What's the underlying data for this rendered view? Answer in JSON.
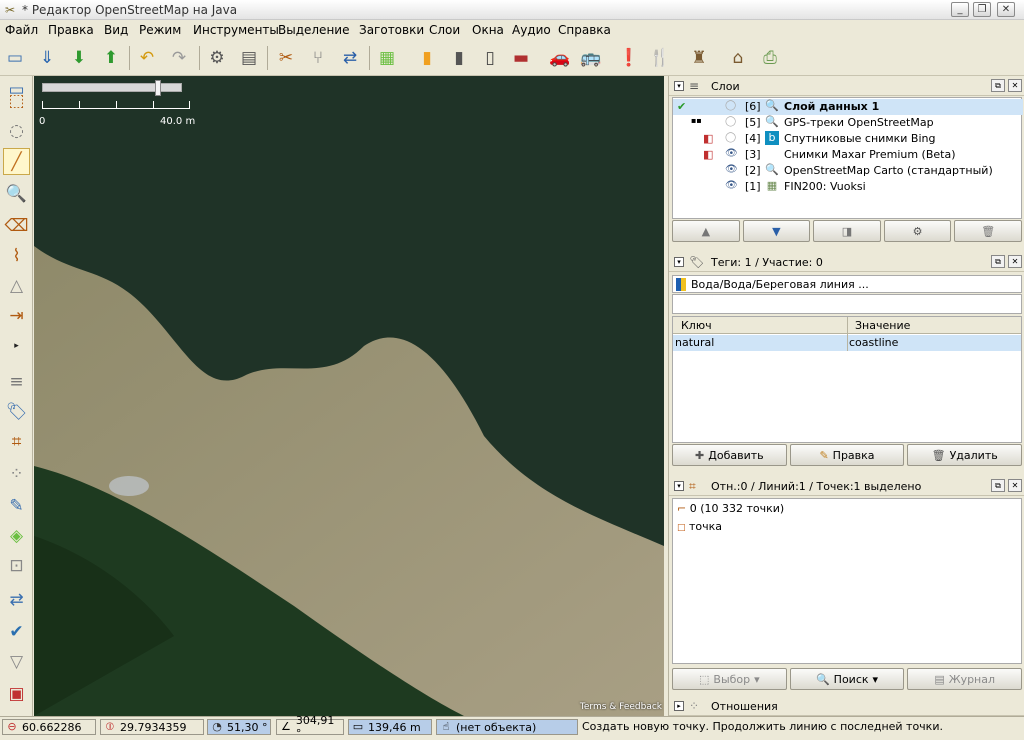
{
  "window": {
    "title": "* Редактор OpenStreetMap на Java",
    "app_icon": "josm-icon",
    "controls": [
      "minimize-icon",
      "restore-icon",
      "close-icon"
    ]
  },
  "menubar": {
    "items": [
      "Файл",
      "Правка",
      "Вид",
      "Режим",
      "Инструменты",
      "Выделение",
      "Заготовки",
      "Слои",
      "Окна",
      "Аудио",
      "Справка"
    ]
  },
  "toolbar": {
    "buttons": [
      "open-file-icon",
      "save-icon",
      "download-icon",
      "upload-icon",
      "undo-icon",
      "redo-icon",
      "preferences-icon",
      "layer-properties-icon",
      "split-way-icon",
      "combine-icon",
      "reverse-icon",
      "highway-preset-icon",
      "road-preset-icon",
      "track-preset-icon",
      "barrier-preset-icon",
      "car-icon",
      "bus-icon",
      "warning-icon",
      "restaurant-icon",
      "castle-icon",
      "factory-icon",
      "print-icon"
    ]
  },
  "map": {
    "scale_label_start": "0",
    "scale_label_end": "40.0 m",
    "attribution": "Terms & Feedback",
    "colors": {
      "water": "#1f3327",
      "shore": "#9a9174",
      "forest": "#1e3a20"
    }
  },
  "layers_panel": {
    "title": "Слои",
    "layers": [
      {
        "index": "[6]",
        "name": "Слой данных 1",
        "visible": false,
        "active": true,
        "icon": "data-layer-icon"
      },
      {
        "index": "[5]",
        "name": "GPS-треки OpenStreetMap",
        "visible": false,
        "active": false,
        "icon": "gps-layer-icon"
      },
      {
        "index": "[4]",
        "name": "Спутниковые снимки Bing",
        "visible": false,
        "active": false,
        "icon": "bing-icon"
      },
      {
        "index": "[3]",
        "name": "Снимки Maxar Premium (Beta)",
        "visible": true,
        "active": false,
        "icon": "maxar-icon"
      },
      {
        "index": "[2]",
        "name": "OpenStreetMap Carto (стандартный)",
        "visible": true,
        "active": false,
        "icon": "osm-layer-icon"
      },
      {
        "index": "[1]",
        "name": "FIN200: Vuoksi",
        "visible": true,
        "active": false,
        "icon": "imagery-layer-icon"
      }
    ],
    "buttons": [
      "move-up-icon",
      "move-down-icon",
      "merge-layers-icon",
      "layer-settings-icon",
      "delete-layer-icon"
    ]
  },
  "tags_panel": {
    "title": "Теги: 1 / Участие: 0",
    "preset_name": "Вода/Вода/Береговая линия ...",
    "columns": [
      "Ключ",
      "Значение"
    ],
    "rows": [
      {
        "key": "natural",
        "value": "coastline"
      }
    ],
    "buttons": [
      "Добавить",
      "Правка",
      "Удалить"
    ]
  },
  "selection_panel": {
    "title": "Отн.:0 / Линий:1 / Точек:1 выделено",
    "items": [
      "0 (10 332 точки)",
      "точка"
    ],
    "buttons": [
      "Выбор",
      "Поиск",
      "Журнал"
    ]
  },
  "relations_panel": {
    "title": "Отношения"
  },
  "statusbar": {
    "lat": "60.662286",
    "lon": "29.7934359",
    "heading": "51,30 °",
    "angle": "304,91 °",
    "distance": "139,46 m",
    "object": "(нет объекта)",
    "message": "Создать новую точку. Продолжить линию с последней точки."
  }
}
